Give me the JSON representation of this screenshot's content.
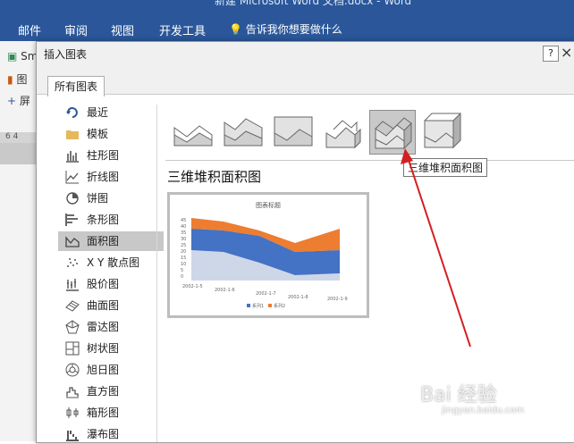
{
  "word": {
    "title": "新建 Microsoft Word 文档.docx - Word",
    "menus": [
      "邮件",
      "审阅",
      "视图",
      "开发工具"
    ],
    "tell_me": "告诉我你想要做什么",
    "left_items": [
      "Sm",
      "图",
      "屏"
    ],
    "ruler": "6 4"
  },
  "dialog": {
    "title": "插入图表",
    "help": "?",
    "close": "×",
    "tab": "所有图表",
    "categories": [
      {
        "label": "最近",
        "icon": "recent-icon"
      },
      {
        "label": "模板",
        "icon": "folder-icon"
      },
      {
        "label": "柱形图",
        "icon": "column-chart-icon"
      },
      {
        "label": "折线图",
        "icon": "line-chart-icon"
      },
      {
        "label": "饼图",
        "icon": "pie-chart-icon"
      },
      {
        "label": "条形图",
        "icon": "bar-chart-icon"
      },
      {
        "label": "面积图",
        "icon": "area-chart-icon",
        "selected": true
      },
      {
        "label": "X Y 散点图",
        "icon": "scatter-chart-icon"
      },
      {
        "label": "股价图",
        "icon": "stock-chart-icon"
      },
      {
        "label": "曲面图",
        "icon": "surface-chart-icon"
      },
      {
        "label": "雷达图",
        "icon": "radar-chart-icon"
      },
      {
        "label": "树状图",
        "icon": "treemap-icon"
      },
      {
        "label": "旭日图",
        "icon": "sunburst-icon"
      },
      {
        "label": "直方图",
        "icon": "histogram-icon"
      },
      {
        "label": "箱形图",
        "icon": "box-whisker-icon"
      },
      {
        "label": "瀑布图",
        "icon": "waterfall-icon"
      }
    ],
    "variant_names": [
      "area",
      "stacked-area",
      "100-stacked-area",
      "3d-area",
      "3d-stacked-area",
      "3d-100-stacked-area"
    ],
    "selected_variant": 4,
    "tooltip": "三维堆积面积图",
    "subtype_title": "三维堆积面积图",
    "preview_title": "图表标题",
    "preview_axis": [
      "45",
      "40",
      "35",
      "30",
      "25",
      "20",
      "15",
      "10",
      "5",
      "0"
    ],
    "preview_dates": [
      "2002-1-5",
      "2002-1-6",
      "2002-1-7",
      "2002-1-8",
      "2002-1-9"
    ],
    "preview_legend": [
      "系列1",
      "系列2"
    ]
  },
  "colors": {
    "ribbon": "#2b579a",
    "series1": "#4472c4",
    "series2": "#ed7d31",
    "arrow": "#d32020"
  },
  "watermark": {
    "main": "Bai 经验",
    "sub": "jingyan.baidu.com"
  }
}
